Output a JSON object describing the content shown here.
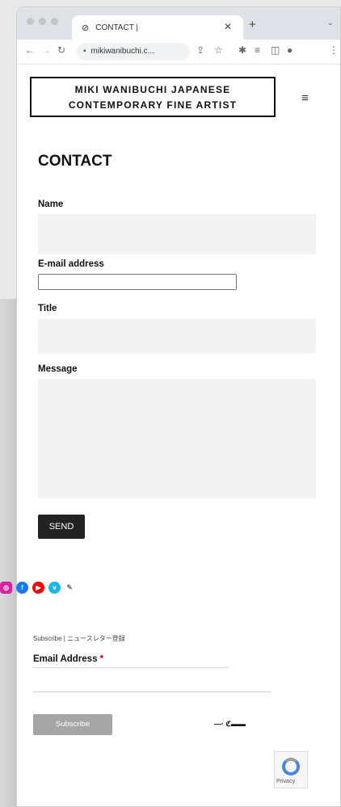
{
  "browser": {
    "tab_title": "CONTACT |",
    "url": "mikiwanibuchi.c..."
  },
  "site": {
    "logo_line1": "MIKI WANIBUCHI JAPANESE",
    "logo_line2": "CONTEMPORARY FINE ARTIST",
    "menu_icon": "hamburger-icon"
  },
  "contact": {
    "heading": "CONTACT",
    "name_label": "Name",
    "email_label": "E-mail address",
    "title_label": "Title",
    "message_label": "Message",
    "send_label": "SEND"
  },
  "social": {
    "icons": [
      "instagram-icon",
      "facebook-icon",
      "youtube-icon",
      "vimeo-icon",
      "link-icon"
    ]
  },
  "subscribe": {
    "title": "Subscribe | ニュースレター登録",
    "email_label": "Email Address",
    "required_mark": "*",
    "button_label": "Subscribe"
  },
  "recaptcha": {
    "text": "Privacy"
  },
  "colors": {
    "send_button": "#222222",
    "subscribe_button": "#a6a6a6",
    "required": "#cc0000"
  }
}
